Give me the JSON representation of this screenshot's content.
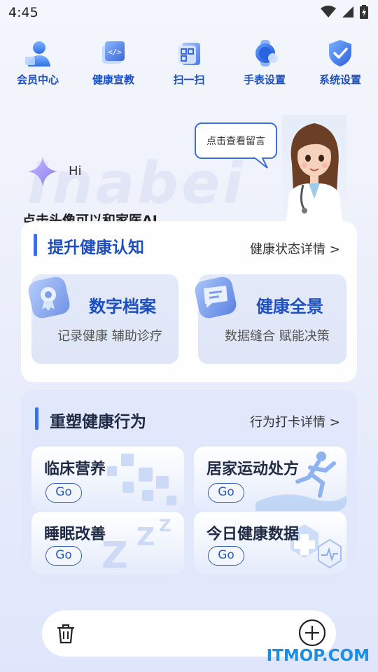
{
  "status": {
    "time": "4:45"
  },
  "functions": [
    {
      "label": "会员中心",
      "icon": "member-icon"
    },
    {
      "label": "健康宣教",
      "icon": "education-icon"
    },
    {
      "label": "扫一扫",
      "icon": "scan-icon"
    },
    {
      "label": "手表设置",
      "icon": "watch-icon"
    },
    {
      "label": "系统设置",
      "icon": "shield-icon"
    }
  ],
  "greeting": {
    "text": "Hi",
    "hint": "点击头像可以和家医AI",
    "watermark": "Inabei"
  },
  "assistant": {
    "bubble": "点击查看留言"
  },
  "cognition": {
    "title": "提升健康认知",
    "link": "健康状态详情 >",
    "tiles": [
      {
        "title": "数字档案",
        "sub": "记录健康 辅助诊疗",
        "icon": "certificate-icon"
      },
      {
        "title": "健康全景",
        "sub": "数据缝合 赋能决策",
        "icon": "chat-card-icon"
      }
    ]
  },
  "behavior": {
    "title": "重塑健康行为",
    "link": "行为打卡详情 >",
    "tiles": [
      {
        "title": "临床营养",
        "go": "Go"
      },
      {
        "title": "居家运动处方",
        "go": "Go"
      },
      {
        "title": "睡眠改善",
        "go": "Go"
      },
      {
        "title": "今日健康数据",
        "go": "Go"
      }
    ]
  },
  "brand": "ITMOP.COM",
  "colors": {
    "accent": "#1d4fbf",
    "bar": "#3f6fd8"
  }
}
